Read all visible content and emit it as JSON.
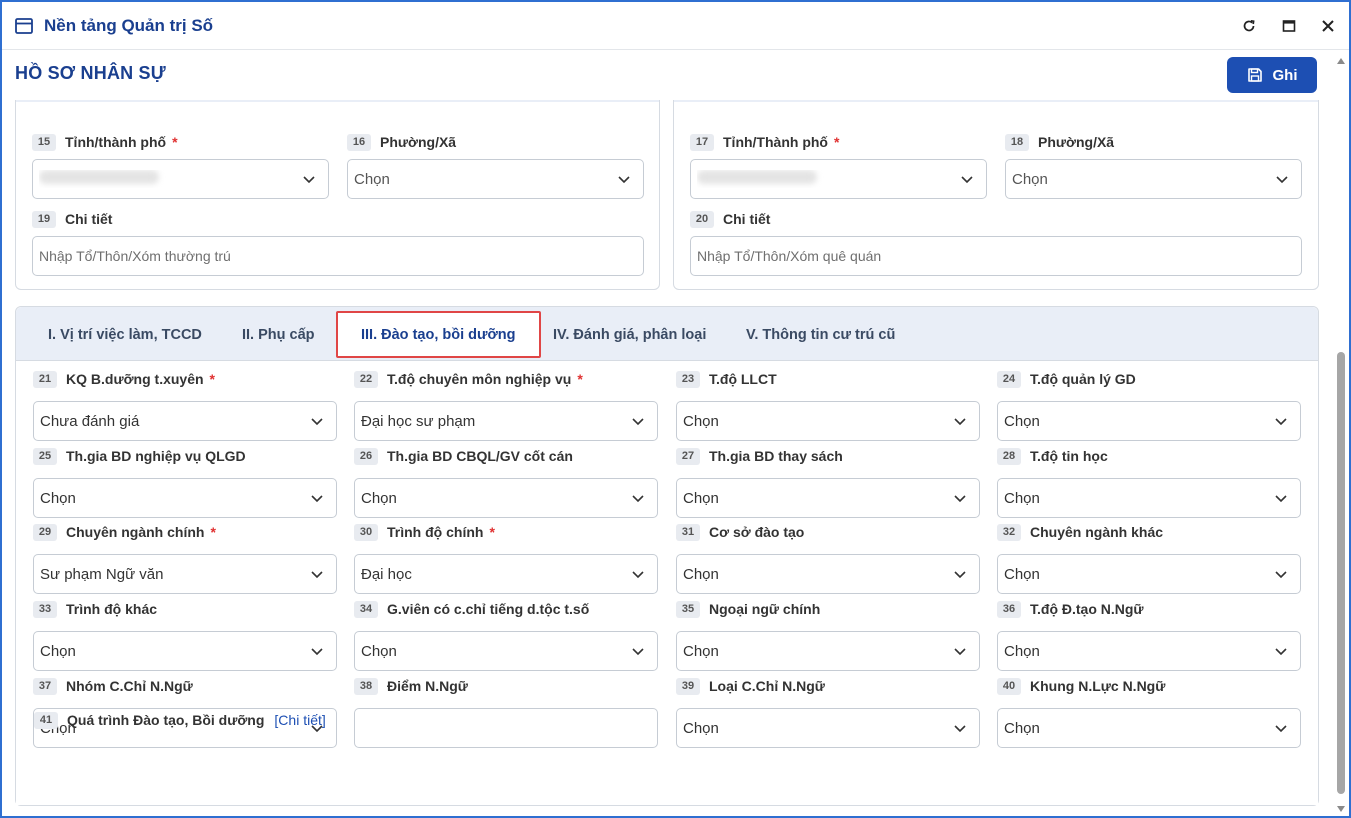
{
  "window": {
    "title": "Nền tảng Quản trị Số"
  },
  "header": {
    "page_title": "HỒ SƠ NHÂN SỰ",
    "save_label": "Ghi"
  },
  "address_left": {
    "province": {
      "num": "15",
      "label": "Tỉnh/thành phố",
      "required": "*"
    },
    "ward": {
      "num": "16",
      "label": "Phường/Xã",
      "value": "Chọn"
    },
    "detail": {
      "num": "19",
      "label": "Chi tiết",
      "placeholder": "Nhập Tổ/Thôn/Xóm thường trú"
    }
  },
  "address_right": {
    "province": {
      "num": "17",
      "label": "Tỉnh/Thành phố",
      "required": "*"
    },
    "ward": {
      "num": "18",
      "label": "Phường/Xã",
      "value": "Chọn"
    },
    "detail": {
      "num": "20",
      "label": "Chi tiết",
      "placeholder": "Nhập Tổ/Thôn/Xóm quê quán"
    }
  },
  "tabs": [
    {
      "label": "I. Vị trí việc làm, TCCD"
    },
    {
      "label": "II. Phụ cấp"
    },
    {
      "label": "III. Đào tạo, bồi dưỡng",
      "active": true
    },
    {
      "label": "IV. Đánh giá, phân loại"
    },
    {
      "label": "V. Thông tin cư trú cũ"
    }
  ],
  "fields": [
    {
      "num": "21",
      "label": "KQ B.dưỡng t.xuyên",
      "required": "*",
      "value": "Chưa đánh giá"
    },
    {
      "num": "22",
      "label": "T.độ chuyên môn nghiệp vụ",
      "required": "*",
      "value": "Đại học sư phạm"
    },
    {
      "num": "23",
      "label": "T.độ LLCT",
      "value": "Chọn"
    },
    {
      "num": "24",
      "label": "T.độ quản lý GD",
      "value": "Chọn"
    },
    {
      "num": "25",
      "label": "Th.gia BD nghiệp vụ QLGD",
      "value": "Chọn"
    },
    {
      "num": "26",
      "label": "Th.gia BD CBQL/GV cốt cán",
      "value": "Chọn"
    },
    {
      "num": "27",
      "label": "Th.gia BD thay sách",
      "value": "Chọn"
    },
    {
      "num": "28",
      "label": "T.độ tin học",
      "value": "Chọn"
    },
    {
      "num": "29",
      "label": "Chuyên ngành chính",
      "required": "*",
      "value": "Sư phạm Ngữ văn"
    },
    {
      "num": "30",
      "label": "Trình độ chính",
      "required": "*",
      "value": "Đại học"
    },
    {
      "num": "31",
      "label": "Cơ sở đào tạo",
      "value": "Chọn"
    },
    {
      "num": "32",
      "label": "Chuyên ngành khác",
      "value": "Chọn"
    },
    {
      "num": "33",
      "label": "Trình độ khác",
      "value": "Chọn"
    },
    {
      "num": "34",
      "label": "G.viên có c.chỉ tiếng d.tộc t.số",
      "value": "Chọn"
    },
    {
      "num": "35",
      "label": "Ngoại ngữ chính",
      "value": "Chọn"
    },
    {
      "num": "36",
      "label": "T.độ Đ.tạo N.Ngữ",
      "value": "Chọn"
    },
    {
      "num": "37",
      "label": "Nhóm C.Chỉ N.Ngữ",
      "value": "Chọn"
    },
    {
      "num": "38",
      "label": "Điểm N.Ngữ",
      "value": ""
    },
    {
      "num": "39",
      "label": "Loại C.Chỉ N.Ngữ",
      "value": "Chọn"
    },
    {
      "num": "40",
      "label": "Khung N.Lực N.Ngữ",
      "value": "Chọn"
    }
  ],
  "training_process": {
    "num": "41",
    "label": "Quá trình Đào tạo, Bồi dưỡng",
    "link": "[Chi tiết]"
  },
  "colors": {
    "accent": "#1d4fb3",
    "title": "#1a3f8f",
    "required": "#e03131",
    "active_tab_border": "#e04646"
  },
  "icons": [
    "window-icon",
    "refresh-icon",
    "maximize-icon",
    "close-icon",
    "save-icon",
    "chevron-down-icon"
  ]
}
